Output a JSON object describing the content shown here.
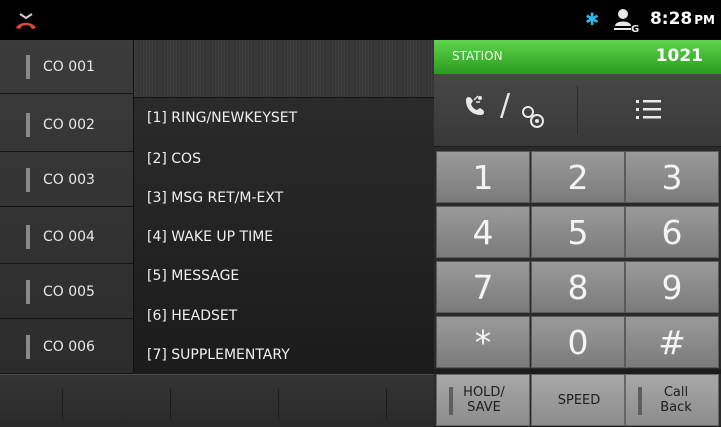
{
  "status_bar": {
    "time": "8:28",
    "ampm": "PM",
    "icons": [
      "handset-hangup-icon",
      "bluetooth-icon",
      "user-g-icon"
    ],
    "bluetooth_glyph": "✱"
  },
  "co_lines": [
    {
      "label": "CO 001"
    },
    {
      "label": "CO 002"
    },
    {
      "label": "CO 003"
    },
    {
      "label": "CO 004"
    },
    {
      "label": "CO 005"
    },
    {
      "label": "CO 006"
    }
  ],
  "menu": {
    "items": [
      "[1] RING/NEWKEYSET",
      "[2] COS",
      "[3] MSG RET/M-EXT",
      "[4] WAKE UP TIME",
      "[5] MESSAGE",
      "[6] HEADSET",
      "[7] SUPPLEMENTARY"
    ]
  },
  "station": {
    "label": "STATION",
    "number": "1021"
  },
  "tools": {
    "left_separator": "/",
    "icons": [
      "call-settings-icon",
      "gear-icon",
      "list-icon"
    ]
  },
  "keypad": {
    "keys": [
      "1",
      "2",
      "3",
      "4",
      "5",
      "6",
      "7",
      "8",
      "9",
      "*",
      "0",
      "#"
    ]
  },
  "softkeys": {
    "hold_save": "HOLD/\nSAVE",
    "speed": "SPEED",
    "call_back": "Call\nBack"
  },
  "colors": {
    "station_bar": "#3fb52e",
    "bluetooth": "#33b5e5",
    "hangup_icon": "#e0463a"
  }
}
